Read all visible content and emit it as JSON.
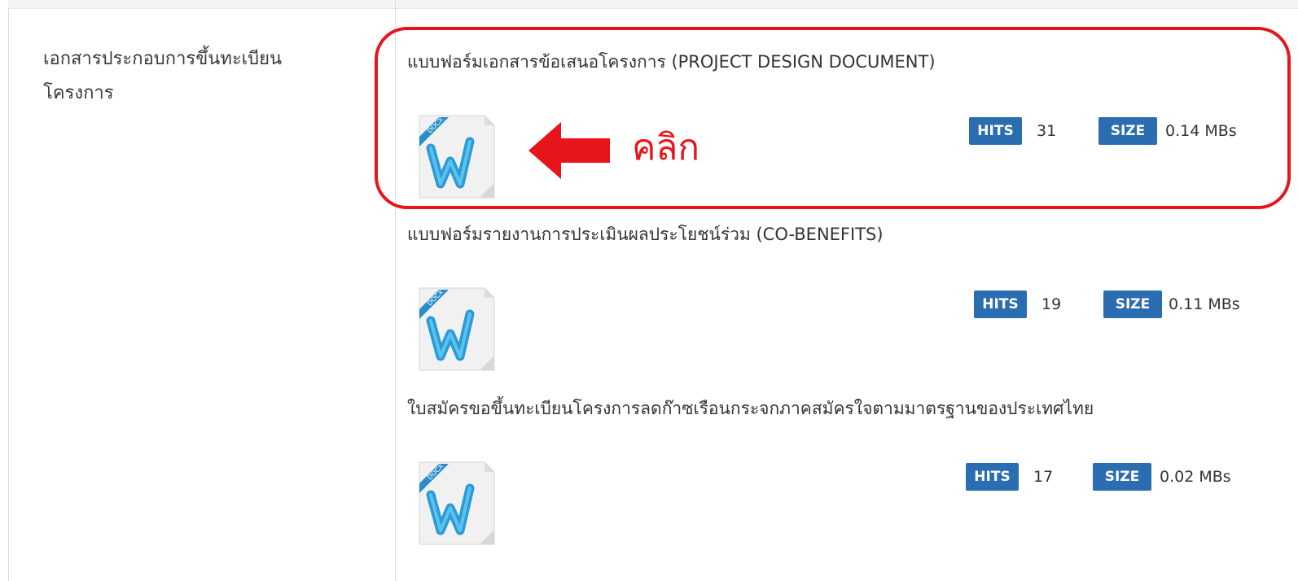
{
  "label_cell": {
    "line1": "เอกสารประกอบการขึ้นทะเบียน",
    "line2": "โครงการ"
  },
  "documents": [
    {
      "title": "แบบฟอร์มเอกสารข้อเสนอโครงการ (PROJECT DESIGN DOCUMENT)",
      "icon": "docx-word-icon",
      "hits_label": "HITS",
      "hits": "31",
      "size_label": "SIZE",
      "size": "0.14 MBs"
    },
    {
      "title": "แบบฟอร์มรายงานการประเมินผลประโยชน์ร่วม (CO-BENEFITS)",
      "icon": "docx-word-icon",
      "hits_label": "HITS",
      "hits": "19",
      "size_label": "SIZE",
      "size": "0.11 MBs"
    },
    {
      "title": "ใบสมัครขอขึ้นทะเบียนโครงการลดก๊าซเรือนกระจกภาคสมัครใจตามมาตรฐานของประเทศไทย",
      "icon": "docx-word-icon",
      "hits_label": "HITS",
      "hits": "17",
      "size_label": "SIZE",
      "size": "0.02 MBs"
    }
  ],
  "annotation": {
    "click_text": "คลิก",
    "arrow_icon": "left-arrow-icon",
    "color": "#e8141b"
  },
  "colors": {
    "badge": "#2a6db0",
    "text": "#333333",
    "border": "#dcdcdc"
  },
  "icon_label": "DOCX"
}
